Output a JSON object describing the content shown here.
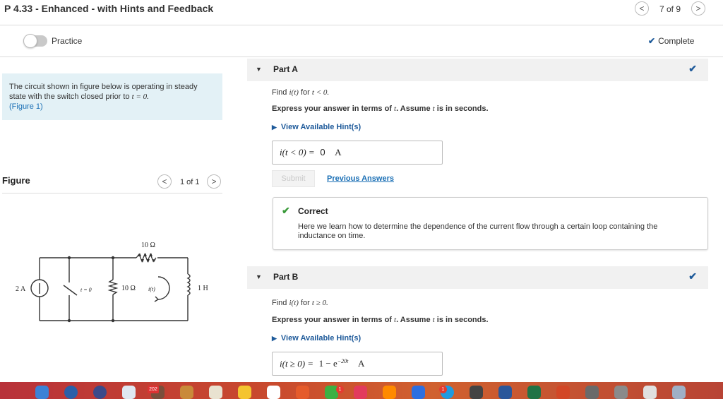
{
  "header": {
    "title": "P 4.33 - Enhanced - with Hints and Feedback",
    "pager": {
      "prev": "<",
      "text": "7 of 9",
      "next": ">"
    }
  },
  "practice_row": {
    "label": "Practice",
    "status_check": "✔",
    "status_label": "Complete"
  },
  "intro": {
    "text": "The circuit shown in figure below is operating in steady state with the switch closed prior to",
    "math": "t = 0.",
    "link": "(Figure 1)"
  },
  "figure": {
    "heading": "Figure",
    "prev": "<",
    "count": "1 of 1",
    "next": ">",
    "labels": {
      "source": "2 A",
      "switch": "t = 0",
      "r_top": "10 Ω",
      "r_mid": "10 Ω",
      "current": "i(t)",
      "inductor": "1 H"
    }
  },
  "partA": {
    "label": "Part A",
    "find_prefix": "Find",
    "find_math": "i(t)",
    "find_for": "for",
    "find_cond": "t < 0.",
    "express": "Express your answer in terms of",
    "express_var": "t",
    "assume": ". Assume",
    "assume_var": "t",
    "assume_end": "is in seconds.",
    "hint": "View Available Hint(s)",
    "answer_lhs": "i(t < 0) =",
    "answer_value": "0",
    "answer_unit": "A",
    "submit": "Submit",
    "previous_answers": "Previous Answers",
    "feedback_title": "Correct",
    "feedback_text": "Here we learn how to determine the dependence of the current flow through a certain loop containing the inductance on time."
  },
  "partB": {
    "label": "Part B",
    "find_prefix": "Find",
    "find_math": "i(t)",
    "find_for": "for",
    "find_cond": "t ≥ 0.",
    "express": "Express your answer in terms of",
    "express_var": "t",
    "assume": ". Assume",
    "assume_var": "t",
    "assume_end": "is in seconds.",
    "hint": "View Available Hint(s)",
    "answer_lhs": "i(t ≥ 0) =",
    "answer_base": "1 − e",
    "answer_exp": "−20t",
    "answer_unit": "A"
  },
  "dock": {
    "badges": [
      "1",
      "1"
    ],
    "calendar_label": "202",
    "colors": [
      "#3b82d6",
      "#2a5fa8",
      "#3b4a8a",
      "#dfe8f2",
      "#7a4e3b",
      "#c98a3a",
      "#e9e2d0",
      "#f4c430",
      "#ffffff",
      "#e55b2b",
      "#3cb043",
      "#e23b5d",
      "#ff8a00",
      "#2d6fe0",
      "#1f9be0",
      "#444444",
      "#2b579a",
      "#217346",
      "#d24726",
      "#6a6a6a",
      "#8a8a8a",
      "#e0e0e0",
      "#9fb0c6"
    ]
  }
}
